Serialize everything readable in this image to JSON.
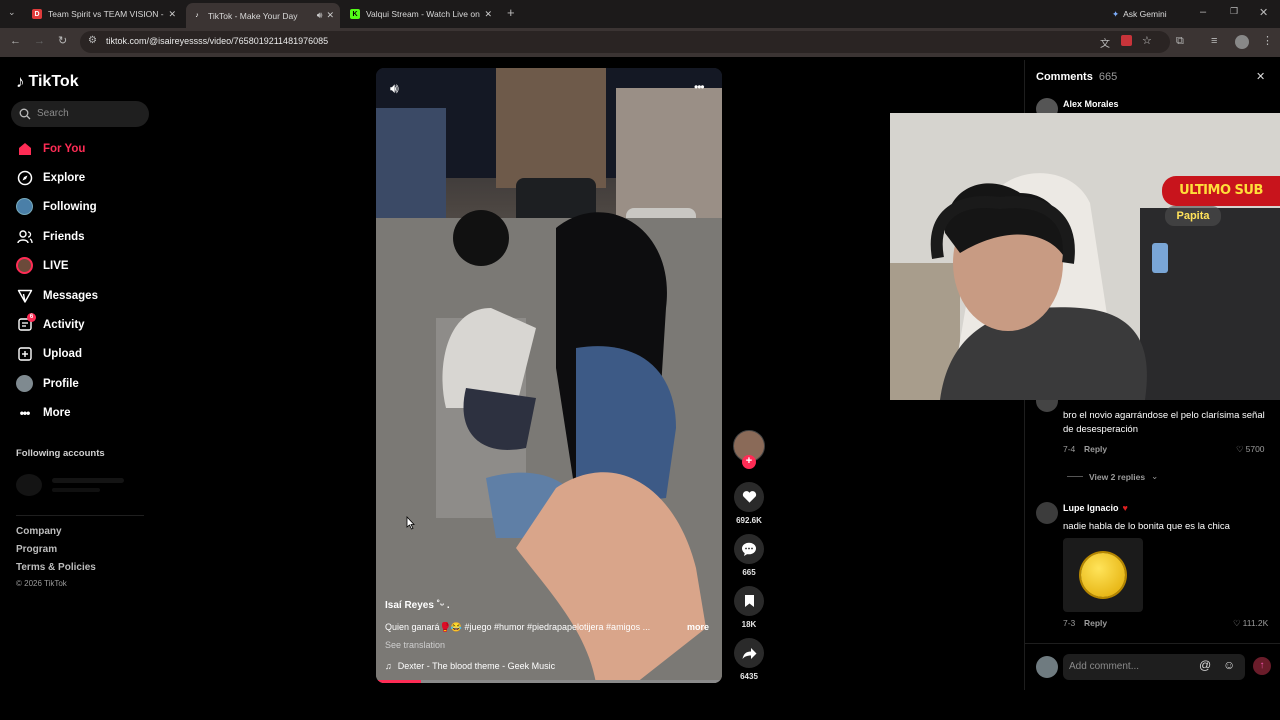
{
  "browser": {
    "tabs": [
      {
        "title": "Team Spirit vs TEAM VISION - T",
        "favicon": "D",
        "color": "#e03b3b"
      },
      {
        "title": "TikTok - Make Your Day",
        "favicon": "tiktok-icon",
        "color": "#000000"
      },
      {
        "title": "Valqui Stream - Watch Live on",
        "favicon": "K",
        "color": "#53fc18"
      }
    ],
    "ask_gemini": "Ask Gemini",
    "url": "tiktok.com/@isaireyessss/video/7658019211481976085"
  },
  "sidebar": {
    "logo": "TikTok",
    "search_placeholder": "Search",
    "nav": [
      {
        "label": "For You",
        "icon": "home-icon"
      },
      {
        "label": "Explore",
        "icon": "compass-icon"
      },
      {
        "label": "Following",
        "icon": "avatar-icon"
      },
      {
        "label": "Friends",
        "icon": "friends-icon"
      },
      {
        "label": "LIVE",
        "icon": "live-avatar-icon"
      },
      {
        "label": "Messages",
        "icon": "messages-icon"
      },
      {
        "label": "Activity",
        "icon": "activity-icon",
        "badge": "6"
      },
      {
        "label": "Upload",
        "icon": "upload-icon"
      },
      {
        "label": "Profile",
        "icon": "profile-avatar-icon"
      },
      {
        "label": "More",
        "icon": "more-icon"
      }
    ],
    "following_accounts": "Following accounts",
    "footer": [
      "Company",
      "Program",
      "Terms & Policies"
    ],
    "copyright": "© 2026 TikTok"
  },
  "video": {
    "author": "Isaí Reyes ˚ᵕ .",
    "description": "Quien ganará🥊😂 #juego #humor #piedrapapelotijera #amigos ...",
    "more": "more",
    "see_translation": "See translation",
    "music": "Dexter - The blood theme - Geek Music",
    "progress": 0.13
  },
  "actions": {
    "likes": "692.6K",
    "comments": "665",
    "saves": "18K",
    "shares": "6435"
  },
  "comments_panel": {
    "title": "Comments",
    "count": "665",
    "first_user": "Alex Morales",
    "c1_text": "bro el novio agarrándose el pelo clarísima señal de desesperación",
    "c1_date": "7-4",
    "c1_reply": "Reply",
    "c1_likes": "5700",
    "view_replies": "View 2 replies",
    "c2_user": "Lupe Ignacio",
    "c2_text": "nadie habla de lo bonita que es la chica",
    "c2_date": "7-3",
    "c2_reply": "Reply",
    "c2_likes": "111.2K",
    "add_comment": "Add comment..."
  },
  "stream_overlay": {
    "banner": "ULTIMO SUB",
    "name": "Papita"
  }
}
